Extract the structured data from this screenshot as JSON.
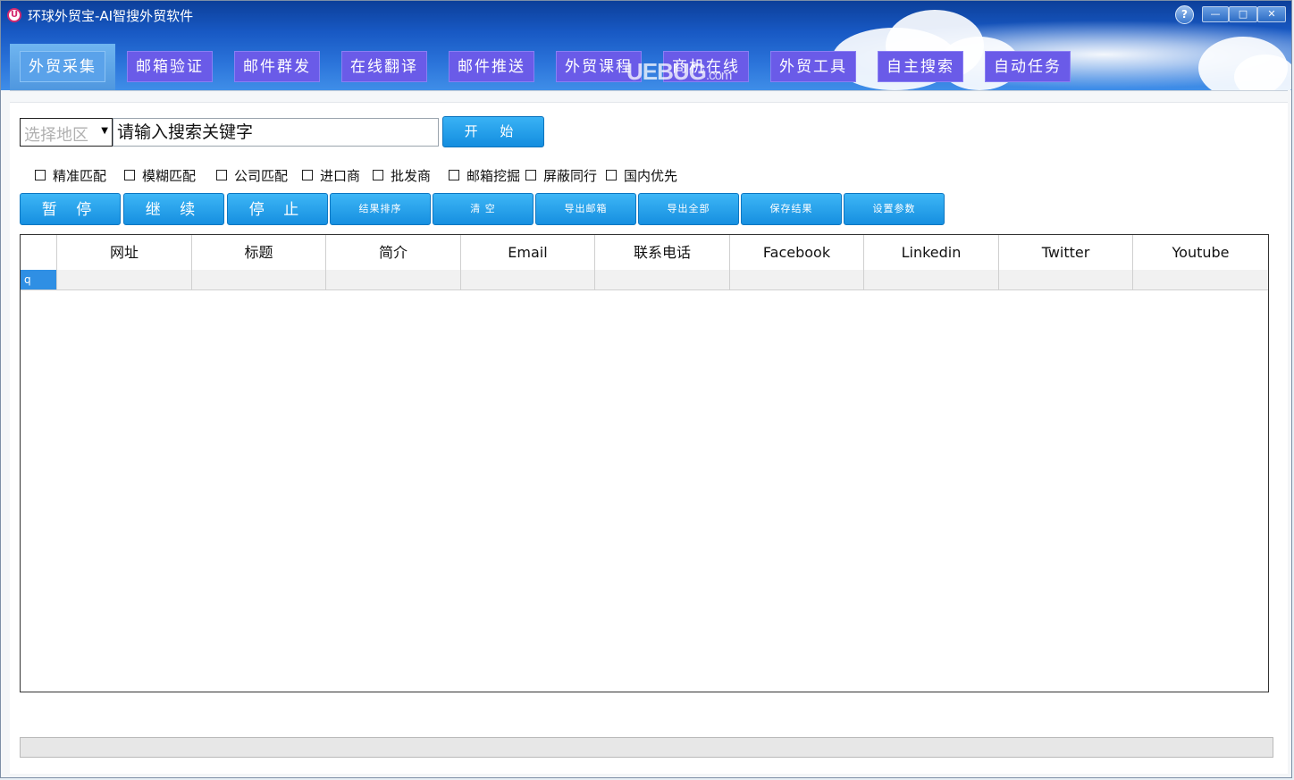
{
  "window": {
    "title": "环球外贸宝-AI智搜外贸软件",
    "controls": {
      "help": "?",
      "minimize": "—",
      "maximize": "□",
      "close": "✕"
    }
  },
  "tabs": [
    {
      "label": "外贸采集",
      "active": true
    },
    {
      "label": "邮箱验证",
      "active": false
    },
    {
      "label": "邮件群发",
      "active": false
    },
    {
      "label": "在线翻译",
      "active": false
    },
    {
      "label": "邮件推送",
      "active": false
    },
    {
      "label": "外贸课程",
      "active": false
    },
    {
      "label": "商机在线",
      "active": false
    },
    {
      "label": "外贸工具",
      "active": false
    },
    {
      "label": "自主搜索",
      "active": false
    },
    {
      "label": "自动任务",
      "active": false
    }
  ],
  "watermark": {
    "main": "UEBUG",
    "suffix": ".com"
  },
  "search": {
    "region_placeholder": "选择地区",
    "keyword_placeholder": "请输入搜索关键字",
    "start_label": "开 始"
  },
  "options": [
    {
      "label": "精准匹配",
      "checked": false
    },
    {
      "label": "模糊匹配",
      "checked": false
    },
    {
      "label": "公司匹配",
      "checked": false
    },
    {
      "label": "进口商",
      "checked": false
    },
    {
      "label": "批发商",
      "checked": false
    },
    {
      "label": "邮箱挖掘",
      "checked": false
    },
    {
      "label": "屏蔽同行",
      "checked": false
    },
    {
      "label": "国内优先",
      "checked": false
    }
  ],
  "actions": [
    {
      "label": "暂 停"
    },
    {
      "label": "继 续"
    },
    {
      "label": "停 止"
    },
    {
      "label": "结果排序"
    },
    {
      "label": "清 空"
    },
    {
      "label": "导出邮箱"
    },
    {
      "label": "导出全部"
    },
    {
      "label": "保存结果"
    },
    {
      "label": "设置参数"
    }
  ],
  "table": {
    "columns": [
      "",
      "网址",
      "标题",
      "简介",
      "Email",
      "联系电话",
      "Facebook",
      "Linkedin",
      "Twitter",
      "Youtube"
    ],
    "rows": [
      {
        "indicator": "q",
        "cells": [
          "",
          "",
          "",
          "",
          "",
          "",
          "",
          "",
          ""
        ]
      }
    ]
  },
  "colors": {
    "tab_bg": "#6a5be8",
    "tab_active_bg": "#5aa2ea",
    "button_bg": "#1f96e6",
    "selected_cell": "#2f8fe4"
  }
}
